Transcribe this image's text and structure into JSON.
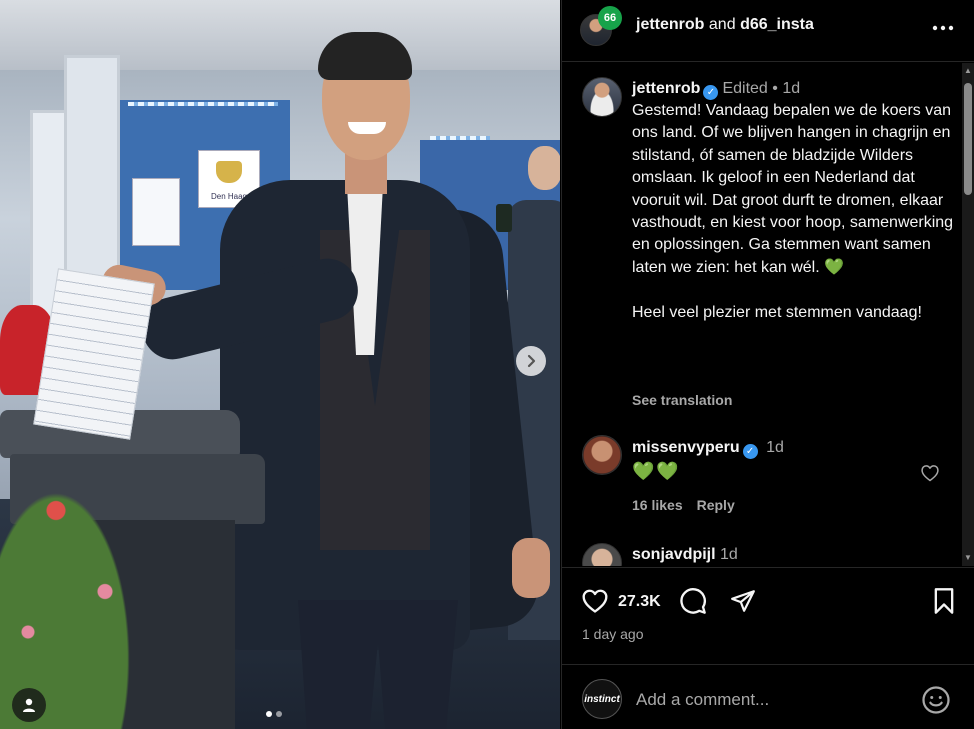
{
  "header": {
    "author": "jettenrob",
    "and_text": "and",
    "coauthor": "d66_insta",
    "badge": "66"
  },
  "photo": {
    "poster_text": "Den Haag",
    "dot_count": 2,
    "active_dot": 0
  },
  "caption": {
    "username": "jettenrob",
    "edited": "Edited",
    "separator": "•",
    "time": "1d",
    "paragraph1": "Gestemd! Vandaag bepalen we de koers van ons land. Of we blijven hangen in chagrijn en stilstand, óf samen de bladzijde Wilders omslaan. Ik geloof in een Nederland dat vooruit wil. Dat groot durft te dromen, elkaar vasthoudt, en kiest voor hoop, samenwerking en oplossingen. Ga stemmen want samen laten we zien: het kan wél.",
    "heart": "💚",
    "paragraph2": "Heel veel plezier met stemmen vandaag!",
    "see_translation": "See translation"
  },
  "comments": [
    {
      "username": "missenvyperu",
      "time": "1d",
      "text": "💚💚",
      "likes": "16 likes",
      "reply": "Reply"
    },
    {
      "username": "sonjavdpijl",
      "time": "1d"
    }
  ],
  "actions": {
    "like_count": "27.3K",
    "posted": "1 day ago"
  },
  "add_comment": {
    "avatar_text": "instinct",
    "placeholder": "Add a comment..."
  },
  "colors": {
    "background": "#000000",
    "text": "#f5f5f5",
    "muted": "#a8a8a8",
    "verified": "#3897f0",
    "badge": "#17a34a",
    "heart_emoji": "#2ecc71"
  },
  "icons": {
    "like": "heart-outline-icon",
    "comment": "speech-bubble-icon",
    "share": "paper-plane-icon",
    "save": "bookmark-icon",
    "more": "ellipsis-icon",
    "next": "chevron-right-icon",
    "tag": "user-icon",
    "emoji": "smiley-icon"
  }
}
